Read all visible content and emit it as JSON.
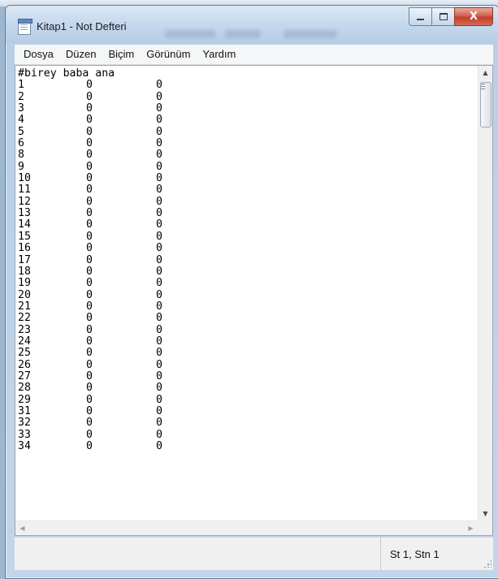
{
  "window": {
    "title": "Kitap1 - Not Defteri",
    "close_glyph": "X",
    "icon": "notepad-icon"
  },
  "menu": [
    {
      "label": "Dosya"
    },
    {
      "label": "Düzen"
    },
    {
      "label": "Biçim"
    },
    {
      "label": "Görünüm"
    },
    {
      "label": "Yardım"
    }
  ],
  "document": {
    "header": "#birey baba ana",
    "rows": [
      [
        "1",
        "0",
        "0"
      ],
      [
        "2",
        "0",
        "0"
      ],
      [
        "3",
        "0",
        "0"
      ],
      [
        "4",
        "0",
        "0"
      ],
      [
        "5",
        "0",
        "0"
      ],
      [
        "6",
        "0",
        "0"
      ],
      [
        "8",
        "0",
        "0"
      ],
      [
        "9",
        "0",
        "0"
      ],
      [
        "10",
        "0",
        "0"
      ],
      [
        "11",
        "0",
        "0"
      ],
      [
        "12",
        "0",
        "0"
      ],
      [
        "13",
        "0",
        "0"
      ],
      [
        "14",
        "0",
        "0"
      ],
      [
        "15",
        "0",
        "0"
      ],
      [
        "16",
        "0",
        "0"
      ],
      [
        "17",
        "0",
        "0"
      ],
      [
        "18",
        "0",
        "0"
      ],
      [
        "19",
        "0",
        "0"
      ],
      [
        "20",
        "0",
        "0"
      ],
      [
        "21",
        "0",
        "0"
      ],
      [
        "22",
        "0",
        "0"
      ],
      [
        "23",
        "0",
        "0"
      ],
      [
        "24",
        "0",
        "0"
      ],
      [
        "25",
        "0",
        "0"
      ],
      [
        "26",
        "0",
        "0"
      ],
      [
        "27",
        "0",
        "0"
      ],
      [
        "28",
        "0",
        "0"
      ],
      [
        "29",
        "0",
        "0"
      ],
      [
        "31",
        "0",
        "0"
      ],
      [
        "32",
        "0",
        "0"
      ],
      [
        "33",
        "0",
        "0"
      ],
      [
        "34",
        "0",
        "0"
      ]
    ]
  },
  "scrollbar": {
    "up_glyph": "▲",
    "down_glyph": "▼",
    "left_glyph": "◀",
    "right_glyph": "▶",
    "vertical_position": 0
  },
  "status": {
    "position": "St 1, Stn 1"
  },
  "colors": {
    "title_bar": "#c4d8ee",
    "close_button": "#c23f2b",
    "editor_bg": "#ffffff"
  }
}
